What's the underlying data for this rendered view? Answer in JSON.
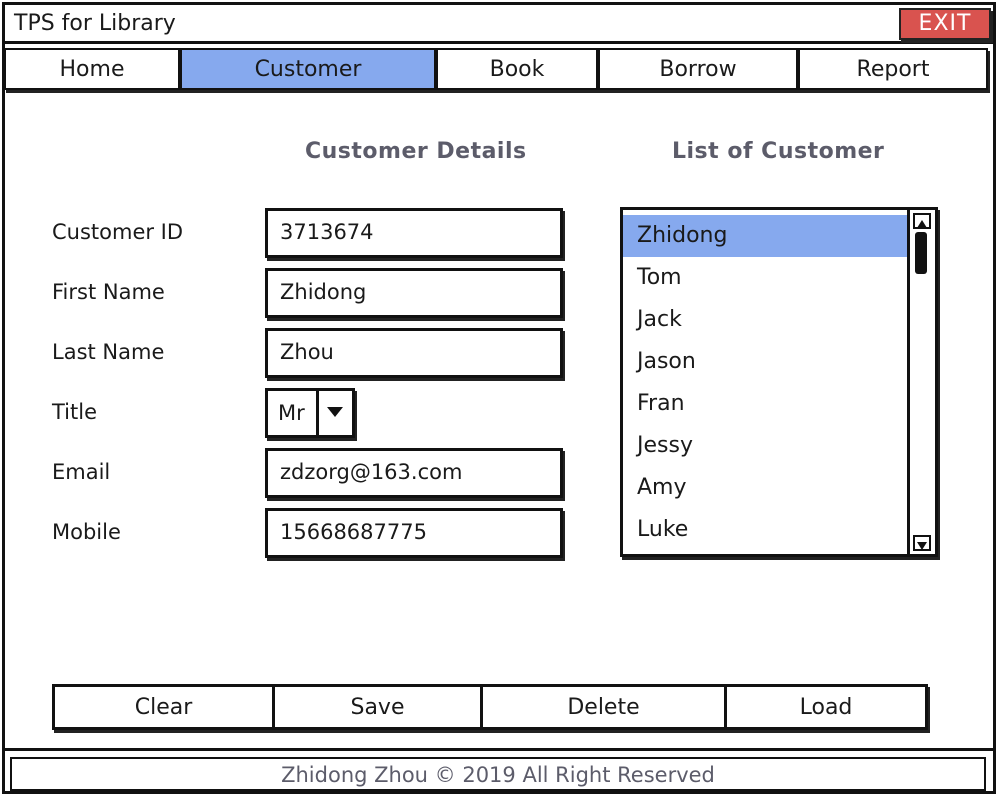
{
  "window": {
    "title": "TPS for Library",
    "exit_label": "EXIT"
  },
  "tabs": [
    {
      "label": "Home",
      "active": false
    },
    {
      "label": "Customer",
      "active": true
    },
    {
      "label": "Book",
      "active": false
    },
    {
      "label": "Borrow",
      "active": false
    },
    {
      "label": "Report",
      "active": false
    }
  ],
  "details": {
    "heading": "Customer Details",
    "fields": {
      "customer_id": {
        "label": "Customer ID",
        "value": "3713674"
      },
      "first_name": {
        "label": "First Name",
        "value": "Zhidong"
      },
      "last_name": {
        "label": "Last Name",
        "value": "Zhou"
      },
      "title": {
        "label": "Title",
        "value": "Mr"
      },
      "email": {
        "label": "Email",
        "value": "zdzorg@163.com"
      },
      "mobile": {
        "label": "Mobile",
        "value": "15668687775"
      }
    }
  },
  "customer_list": {
    "heading": "List of Customer",
    "items": [
      "Zhidong",
      "Tom",
      "Jack",
      "Jason",
      "Fran",
      "Jessy",
      "Amy",
      "Luke"
    ],
    "selected_index": 0
  },
  "actions": {
    "clear": "Clear",
    "save": "Save",
    "delete": "Delete",
    "load": "Load"
  },
  "footer": {
    "text": "Zhidong Zhou © 2019 All Right Reserved"
  },
  "colors": {
    "accent": "#86a9ee",
    "exit": "#d9534f",
    "muted_text": "#5c5c6a"
  }
}
